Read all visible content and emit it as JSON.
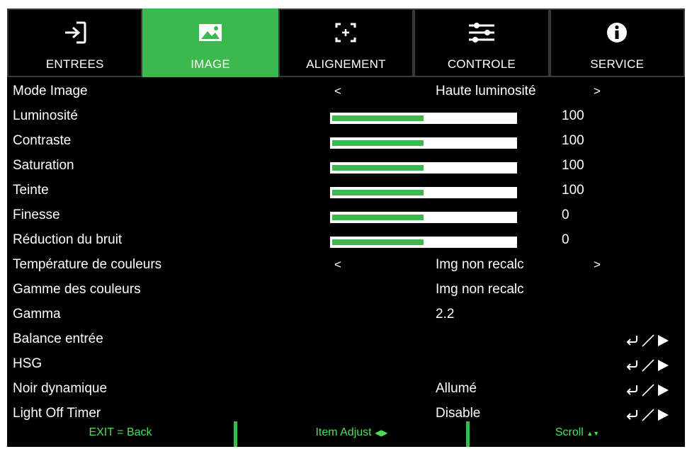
{
  "tabs": [
    {
      "label": "ENTREES",
      "icon": "input-icon",
      "active": false
    },
    {
      "label": "IMAGE",
      "icon": "image-icon",
      "active": true
    },
    {
      "label": "ALIGNEMENT",
      "icon": "alignment-icon",
      "active": false
    },
    {
      "label": "CONTROLE",
      "icon": "sliders-icon",
      "active": false
    },
    {
      "label": "SERVICE",
      "icon": "info-icon",
      "active": false
    }
  ],
  "rows": [
    {
      "label": "Mode Image",
      "kind": "select",
      "value": "Haute luminosité",
      "left": "<",
      "right": ">"
    },
    {
      "label": "Luminosité",
      "kind": "slider",
      "value": "100",
      "level": 0.5
    },
    {
      "label": "Contraste",
      "kind": "slider",
      "value": "100",
      "level": 0.5
    },
    {
      "label": "Saturation",
      "kind": "slider",
      "value": "100",
      "level": 0.5
    },
    {
      "label": "Teinte",
      "kind": "slider",
      "value": "100",
      "level": 0.5
    },
    {
      "label": "Finesse",
      "kind": "slider",
      "value": "0",
      "level": 0.5
    },
    {
      "label": "Réduction du bruit",
      "kind": "slider",
      "value": "0",
      "level": 0.5
    },
    {
      "label": "Température de couleurs",
      "kind": "select",
      "value": "Img non recalc",
      "left": "<",
      "right": ">"
    },
    {
      "label": "Gamme des couleurs",
      "kind": "text",
      "value": "Img non recalc"
    },
    {
      "label": "Gamma",
      "kind": "text",
      "value": "2.2"
    },
    {
      "label": "Balance entrée",
      "kind": "enter",
      "value": ""
    },
    {
      "label": "HSG",
      "kind": "enter",
      "value": ""
    },
    {
      "label": "Noir dynamique",
      "kind": "enter",
      "value": "Allumé"
    },
    {
      "label": "Light Off Timer",
      "kind": "enter",
      "value": "Disable"
    }
  ],
  "footer": {
    "exit": "EXIT = Back",
    "adjust": "Item Adjust",
    "adjust_arrows": "◀▶",
    "scroll": "Scroll",
    "scroll_arrows": "▲▼"
  },
  "colors": {
    "accent": "#3cb94c",
    "footer_text": "#49e05a",
    "background": "#000000",
    "text": "#ffffff"
  }
}
